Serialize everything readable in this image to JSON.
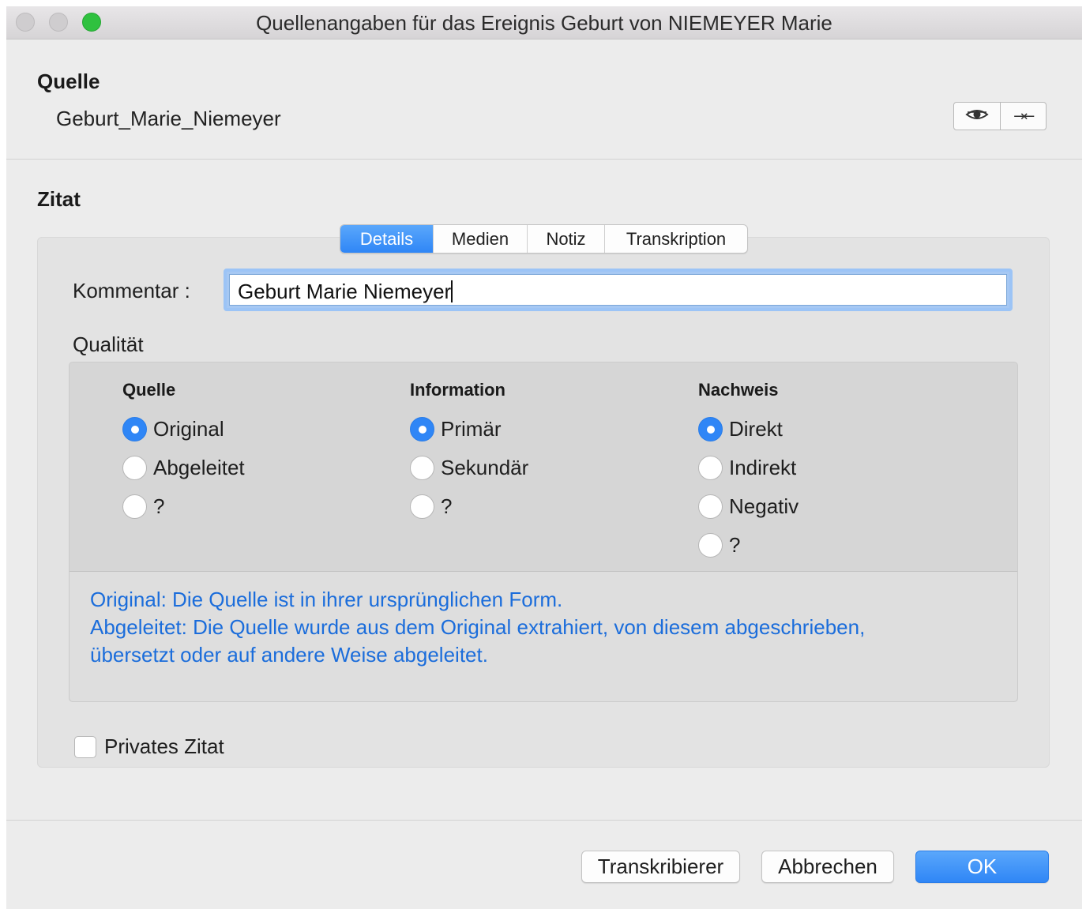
{
  "window": {
    "title": "Quellenangaben für das Ereignis Geburt von NIEMEYER Marie"
  },
  "source": {
    "heading": "Quelle",
    "name": "Geburt_Marie_Niemeyer",
    "buttons": [
      {
        "icon": "eye-icon"
      },
      {
        "icon": "arrows-icon"
      }
    ]
  },
  "citation": {
    "heading": "Zitat",
    "tabs": [
      {
        "label": "Details",
        "active": true
      },
      {
        "label": "Medien",
        "active": false
      },
      {
        "label": "Notiz",
        "active": false
      },
      {
        "label": "Transkription",
        "active": false
      }
    ],
    "comment": {
      "label": "Kommentar :",
      "value": "Geburt Marie Niemeyer"
    },
    "quality": {
      "label": "Qualität",
      "columns": [
        {
          "heading": "Quelle",
          "options": [
            "Original",
            "Abgeleitet",
            "?"
          ],
          "selected": "Original"
        },
        {
          "heading": "Information",
          "options": [
            "Primär",
            "Sekundär",
            "?"
          ],
          "selected": "Primär"
        },
        {
          "heading": "Nachweis",
          "options": [
            "Direkt",
            "Indirekt",
            "Negativ",
            "?"
          ],
          "selected": "Direkt"
        }
      ],
      "description": [
        "Original: Die Quelle ist in ihrer ursprünglichen Form.",
        "Abgeleitet: Die Quelle wurde aus dem Original extrahiert, von diesem abgeschrieben,",
        "übersetzt oder auf andere Weise abgeleitet."
      ],
      "description_color": "#1b6ddb"
    },
    "private": {
      "label": "Privates Zitat",
      "checked": false
    }
  },
  "footer": {
    "transcribe_label": "Transkribierer",
    "cancel_label": "Abbrechen",
    "ok_label": "OK"
  },
  "colors": {
    "accent": "#2f86f6",
    "window_bg": "#ececec",
    "zoom": "#2fc13f"
  }
}
